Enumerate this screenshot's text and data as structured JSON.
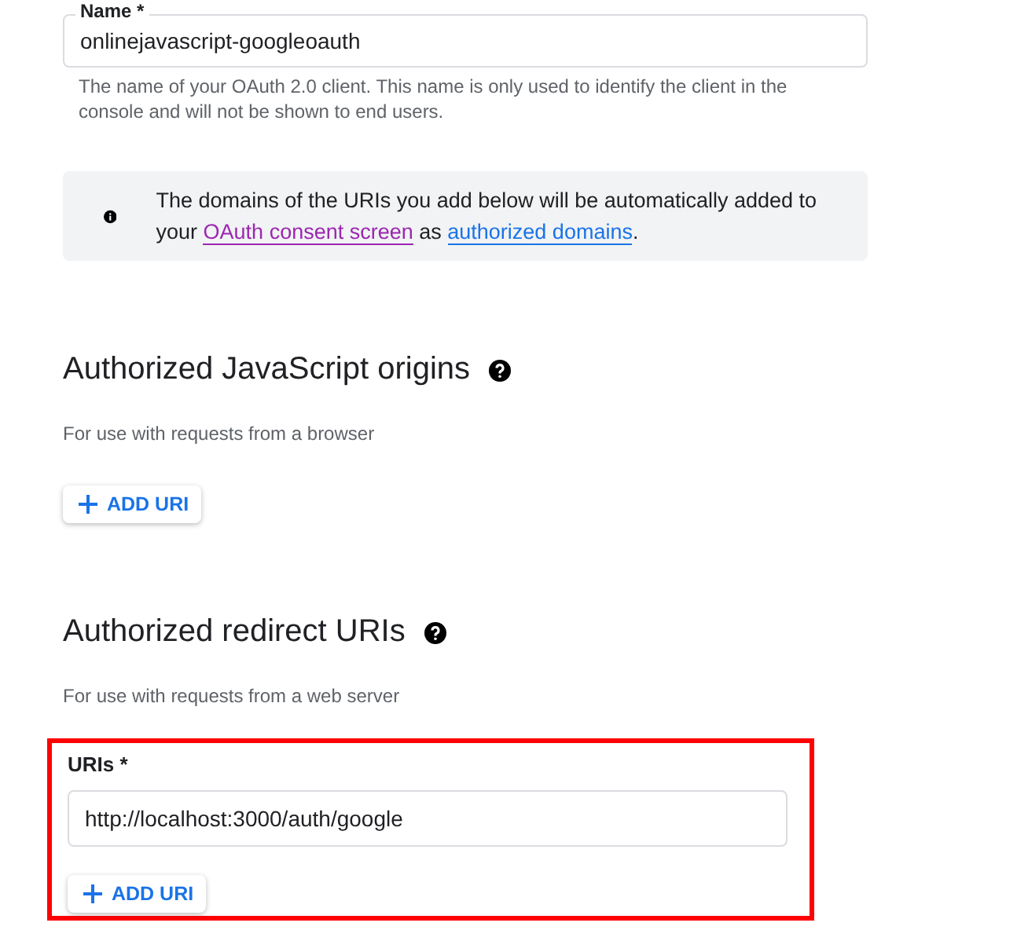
{
  "name_field": {
    "label": "Name *",
    "value": "onlinejavascript-googleoauth",
    "helper": "The name of your OAuth 2.0 client. This name is only used to identify the client in the console and will not be shown to end users."
  },
  "info_banner": {
    "parts": [
      {
        "kind": "text",
        "text": "The domains of the URIs you add below will be automatically added to your "
      },
      {
        "kind": "link",
        "text": "OAuth consent screen",
        "color": "#9c27b0"
      },
      {
        "kind": "text",
        "text": " as "
      },
      {
        "kind": "link",
        "text": "authorized domains",
        "color": "#1a73e8"
      },
      {
        "kind": "text",
        "text": "."
      }
    ]
  },
  "sections": [
    {
      "title": "Authorized JavaScript origins",
      "subtitle": "For use with requests from a browser",
      "button": "ADD URI"
    },
    {
      "title": "Authorized redirect URIs",
      "subtitle": "For use with requests from a web server",
      "highlighted": true,
      "uris_label": "URIs *",
      "uris": [
        "http://localhost:3000/auth/google"
      ],
      "button": "ADD URI"
    }
  ]
}
